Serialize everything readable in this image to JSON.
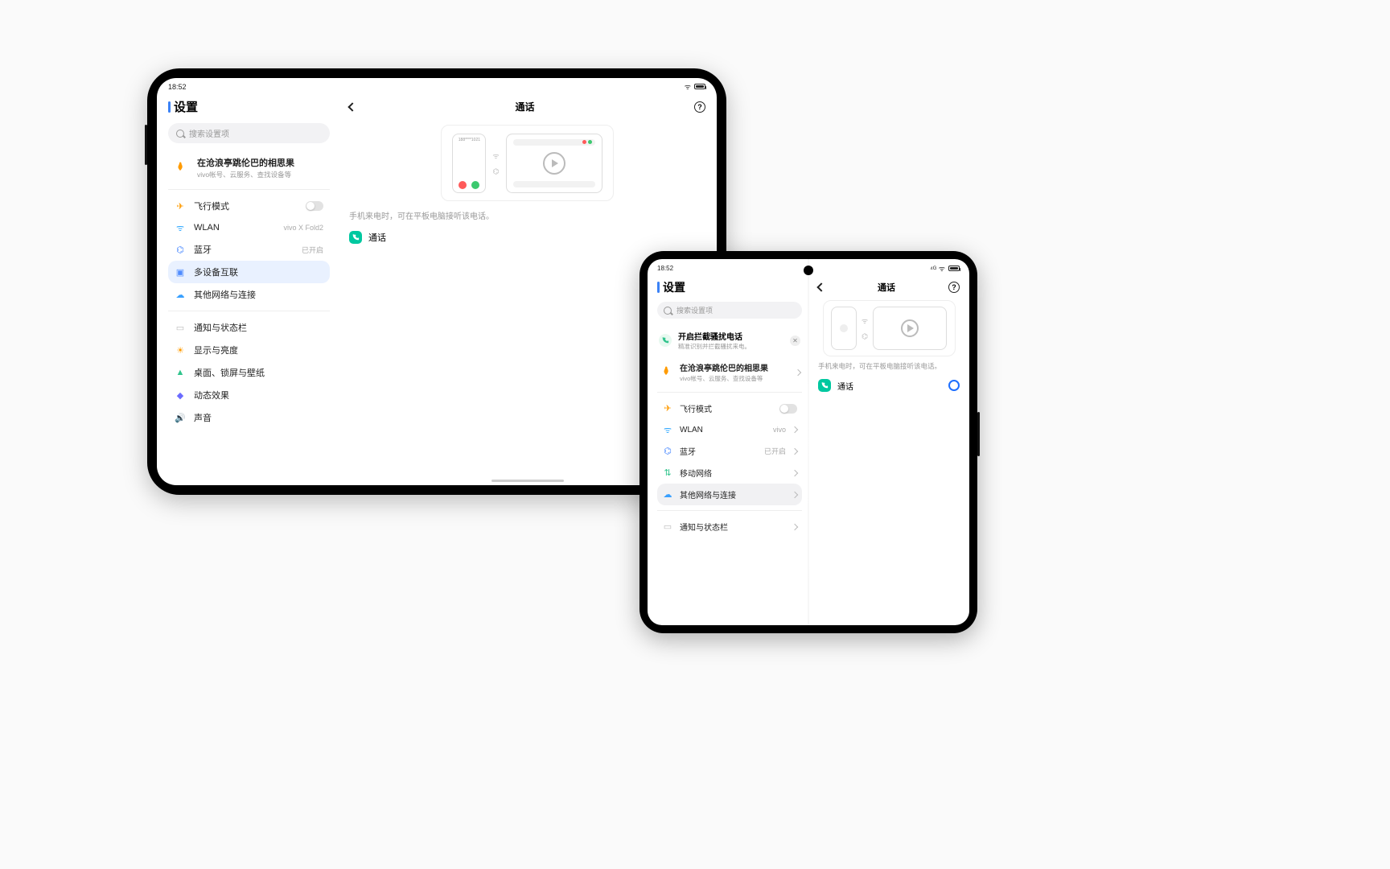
{
  "tablet": {
    "status": {
      "time": "18:52"
    },
    "title": "设置",
    "search": {
      "placeholder": "搜索设置项"
    },
    "account": {
      "name": "在沧浪亭跳伦巴的相思果",
      "sub": "vivo帐号、云服务、查找设备等"
    },
    "rows": {
      "airplane": "飞行模式",
      "wlan": "WLAN",
      "wlan_meta": "vivo X Fold2",
      "bt": "蓝牙",
      "bt_meta": "已开启",
      "multi": "多设备互联",
      "other": "其他网络与连接",
      "notif": "通知与状态栏",
      "display": "显示与亮度",
      "desktop": "桌面、锁屏与壁纸",
      "motion": "动态效果",
      "sound": "声音"
    },
    "right": {
      "title": "通话",
      "desc": "手机来电时，可在平板电脑接听该电话。",
      "call": "通话",
      "il_phone_num": "188****1021"
    }
  },
  "fold": {
    "status": {
      "time": "18:52"
    },
    "title": "设置",
    "search": {
      "placeholder": "搜索设置项"
    },
    "banner": {
      "title": "开启拦截骚扰电话",
      "sub": "精准识别并拦截骚扰来电。"
    },
    "account": {
      "name": "在沧浪亭跳伦巴的相思果",
      "sub": "vivo帐号、云服务、查找设备等"
    },
    "rows": {
      "airplane": "飞行模式",
      "wlan": "WLAN",
      "wlan_meta": "vivo",
      "bt": "蓝牙",
      "bt_meta": "已开启",
      "mobile": "移动网络",
      "other": "其他网络与连接",
      "notif": "通知与状态栏"
    },
    "right": {
      "title": "通话",
      "desc": "手机来电时，可在平板电脑接听该电话。",
      "call": "通话"
    }
  }
}
